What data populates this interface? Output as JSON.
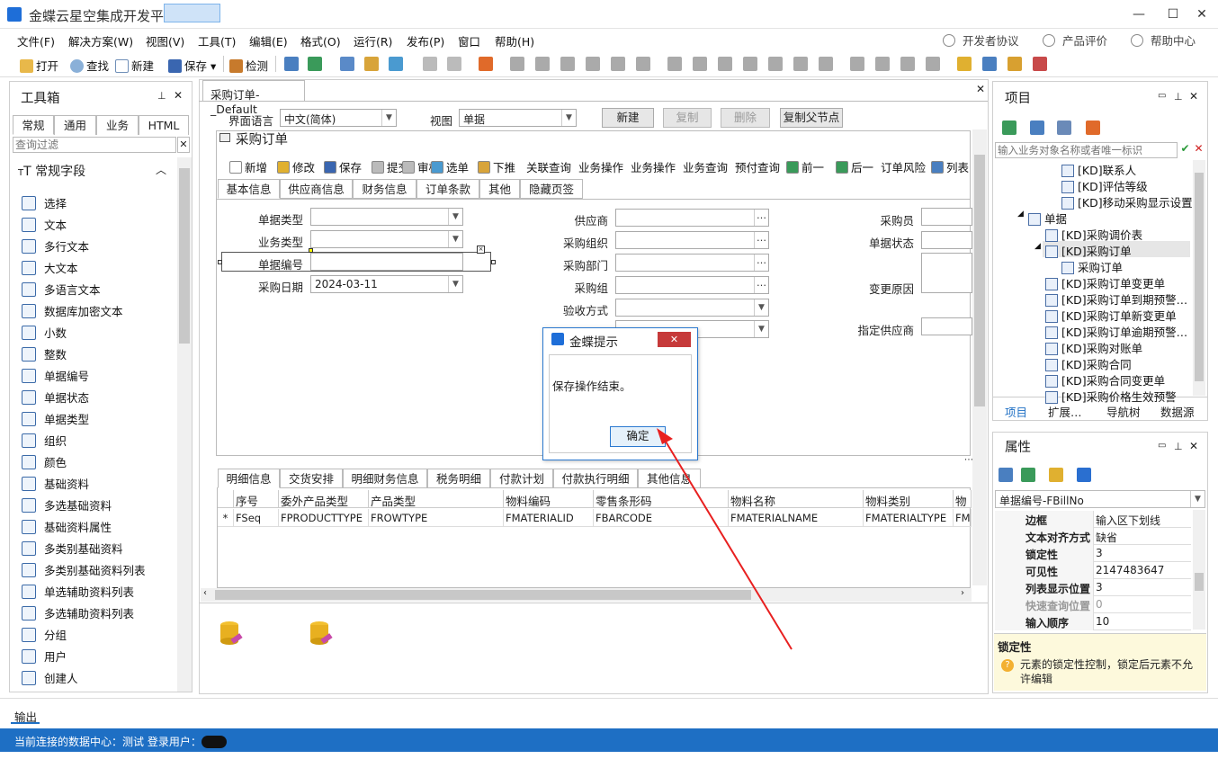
{
  "window": {
    "title": "金蝶云星空集成开发平台"
  },
  "menu": [
    "文件(F)",
    "解决方案(W)",
    "视图(V)",
    "工具(T)",
    "编辑(E)",
    "格式(O)",
    "运行(R)",
    "发布(P)",
    "窗口",
    "帮助(H)"
  ],
  "menu_right": [
    "开发者协议",
    "产品评价",
    "帮助中心"
  ],
  "toolbar": {
    "open": "打开",
    "find": "查找",
    "new": "新建",
    "save": "保存",
    "check": "检测"
  },
  "toolbox": {
    "title": "工具箱",
    "tabs": [
      "常规",
      "通用",
      "业务",
      "HTML"
    ],
    "filter_placeholder": "查询过滤",
    "group": "常规字段",
    "items": [
      "选择",
      "文本",
      "多行文本",
      "大文本",
      "多语言文本",
      "数据库加密文本",
      "小数",
      "整数",
      "单据编号",
      "单据状态",
      "单据类型",
      "组织",
      "颜色",
      "基础资料",
      "多选基础资料",
      "基础资料属性",
      "多类别基础资料",
      "多类别基础资料列表",
      "单选辅助资料列表",
      "多选辅助资料列表",
      "分组",
      "用户",
      "创建人"
    ]
  },
  "doc": {
    "tab": "采购订单-_Default",
    "lang_label": "界面语言",
    "lang_value": "中文(简体)",
    "view_label": "视图",
    "view_value": "单据",
    "btn_new": "新建",
    "btn_copy": "复制",
    "btn_delete": "删除",
    "btn_copy_parent": "复制父节点",
    "form_title": "采购订单",
    "form_toolbar": [
      "新增",
      "修改",
      "保存",
      "提交",
      "审核",
      "选单",
      "下推",
      "关联查询",
      "业务操作",
      "业务操作",
      "业务查询",
      "预付查询",
      "前一",
      "后一",
      "订单风险",
      "列表"
    ],
    "head_tabs": [
      "基本信息",
      "供应商信息",
      "财务信息",
      "订单条款",
      "其他",
      "隐藏页签"
    ],
    "fields_left": [
      "单据类型",
      "业务类型",
      "单据编号",
      "采购日期"
    ],
    "date_value": "2024-03-11",
    "fields_mid": [
      "供应商",
      "采购组织",
      "采购部门",
      "采购组",
      "验收方式"
    ],
    "fields_right": [
      "采购员",
      "单据状态",
      "变更原因",
      "指定供应商"
    ],
    "detail_tabs": [
      "明细信息",
      "交货安排",
      "明细财务信息",
      "税务明细",
      "付款计划",
      "付款执行明细",
      "其他信息"
    ],
    "grid_headers": [
      "序号",
      "委外产品类型",
      "产品类型",
      "物料编码",
      "零售条形码",
      "物料名称",
      "物料类别",
      "物"
    ],
    "grid_row": [
      "*",
      "FSeq",
      "FPRODUCTTYPE",
      "FROWTYPE",
      "FMATERIALID",
      "FBARCODE",
      "FMATERIALNAME",
      "FMATERIALTYPE",
      "FM"
    ]
  },
  "project": {
    "title": "项目",
    "search_placeholder": "输入业务对象名称或者唯一标识",
    "tree": [
      "[KD]联系人",
      "[KD]评估等级",
      "[KD]移动采购显示设置",
      "单据",
      "[KD]采购调价表",
      "[KD]采购订单",
      "采购订单",
      "[KD]采购订单变更单",
      "[KD]采购订单到期预警…",
      "[KD]采购订单新变更单",
      "[KD]采购订单逾期预警…",
      "[KD]采购对账单",
      "[KD]采购合同",
      "[KD]采购合同变更单",
      "[KD]采购价格生效预警"
    ],
    "tabs": [
      "项目",
      "扩展…",
      "导航树",
      "数据源"
    ]
  },
  "props": {
    "title": "属性",
    "selected": "单据编号-FBillNo",
    "rows": [
      [
        "边框",
        "输入区下划线"
      ],
      [
        "文本对齐方式",
        "缺省"
      ],
      [
        "锁定性",
        "3"
      ],
      [
        "可见性",
        "2147483647"
      ],
      [
        "列表显示位置",
        "3"
      ],
      [
        "快速查询位置",
        "0"
      ],
      [
        "输入顺序",
        "10"
      ]
    ],
    "desc_title": "锁定性",
    "desc": "元素的锁定性控制，锁定后元素不允许编辑"
  },
  "output": "输出",
  "status": {
    "text": "当前连接的数据中心：测试  登录用户："
  },
  "dialog": {
    "title": "金蝶提示",
    "message": "保存操作结束。",
    "ok": "确定"
  }
}
